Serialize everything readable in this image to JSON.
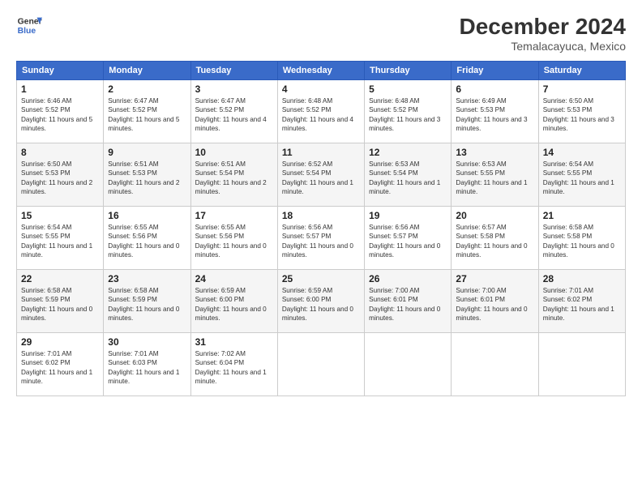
{
  "logo": {
    "line1": "General",
    "line2": "Blue"
  },
  "title": "December 2024",
  "subtitle": "Temalacayuca, Mexico",
  "weekdays": [
    "Sunday",
    "Monday",
    "Tuesday",
    "Wednesday",
    "Thursday",
    "Friday",
    "Saturday"
  ],
  "weeks": [
    [
      {
        "day": "1",
        "info": "Sunrise: 6:46 AM\nSunset: 5:52 PM\nDaylight: 11 hours and 5 minutes."
      },
      {
        "day": "2",
        "info": "Sunrise: 6:47 AM\nSunset: 5:52 PM\nDaylight: 11 hours and 5 minutes."
      },
      {
        "day": "3",
        "info": "Sunrise: 6:47 AM\nSunset: 5:52 PM\nDaylight: 11 hours and 4 minutes."
      },
      {
        "day": "4",
        "info": "Sunrise: 6:48 AM\nSunset: 5:52 PM\nDaylight: 11 hours and 4 minutes."
      },
      {
        "day": "5",
        "info": "Sunrise: 6:48 AM\nSunset: 5:52 PM\nDaylight: 11 hours and 3 minutes."
      },
      {
        "day": "6",
        "info": "Sunrise: 6:49 AM\nSunset: 5:53 PM\nDaylight: 11 hours and 3 minutes."
      },
      {
        "day": "7",
        "info": "Sunrise: 6:50 AM\nSunset: 5:53 PM\nDaylight: 11 hours and 3 minutes."
      }
    ],
    [
      {
        "day": "8",
        "info": "Sunrise: 6:50 AM\nSunset: 5:53 PM\nDaylight: 11 hours and 2 minutes."
      },
      {
        "day": "9",
        "info": "Sunrise: 6:51 AM\nSunset: 5:53 PM\nDaylight: 11 hours and 2 minutes."
      },
      {
        "day": "10",
        "info": "Sunrise: 6:51 AM\nSunset: 5:54 PM\nDaylight: 11 hours and 2 minutes."
      },
      {
        "day": "11",
        "info": "Sunrise: 6:52 AM\nSunset: 5:54 PM\nDaylight: 11 hours and 1 minute."
      },
      {
        "day": "12",
        "info": "Sunrise: 6:53 AM\nSunset: 5:54 PM\nDaylight: 11 hours and 1 minute."
      },
      {
        "day": "13",
        "info": "Sunrise: 6:53 AM\nSunset: 5:55 PM\nDaylight: 11 hours and 1 minute."
      },
      {
        "day": "14",
        "info": "Sunrise: 6:54 AM\nSunset: 5:55 PM\nDaylight: 11 hours and 1 minute."
      }
    ],
    [
      {
        "day": "15",
        "info": "Sunrise: 6:54 AM\nSunset: 5:55 PM\nDaylight: 11 hours and 1 minute."
      },
      {
        "day": "16",
        "info": "Sunrise: 6:55 AM\nSunset: 5:56 PM\nDaylight: 11 hours and 0 minutes."
      },
      {
        "day": "17",
        "info": "Sunrise: 6:55 AM\nSunset: 5:56 PM\nDaylight: 11 hours and 0 minutes."
      },
      {
        "day": "18",
        "info": "Sunrise: 6:56 AM\nSunset: 5:57 PM\nDaylight: 11 hours and 0 minutes."
      },
      {
        "day": "19",
        "info": "Sunrise: 6:56 AM\nSunset: 5:57 PM\nDaylight: 11 hours and 0 minutes."
      },
      {
        "day": "20",
        "info": "Sunrise: 6:57 AM\nSunset: 5:58 PM\nDaylight: 11 hours and 0 minutes."
      },
      {
        "day": "21",
        "info": "Sunrise: 6:58 AM\nSunset: 5:58 PM\nDaylight: 11 hours and 0 minutes."
      }
    ],
    [
      {
        "day": "22",
        "info": "Sunrise: 6:58 AM\nSunset: 5:59 PM\nDaylight: 11 hours and 0 minutes."
      },
      {
        "day": "23",
        "info": "Sunrise: 6:58 AM\nSunset: 5:59 PM\nDaylight: 11 hours and 0 minutes."
      },
      {
        "day": "24",
        "info": "Sunrise: 6:59 AM\nSunset: 6:00 PM\nDaylight: 11 hours and 0 minutes."
      },
      {
        "day": "25",
        "info": "Sunrise: 6:59 AM\nSunset: 6:00 PM\nDaylight: 11 hours and 0 minutes."
      },
      {
        "day": "26",
        "info": "Sunrise: 7:00 AM\nSunset: 6:01 PM\nDaylight: 11 hours and 0 minutes."
      },
      {
        "day": "27",
        "info": "Sunrise: 7:00 AM\nSunset: 6:01 PM\nDaylight: 11 hours and 0 minutes."
      },
      {
        "day": "28",
        "info": "Sunrise: 7:01 AM\nSunset: 6:02 PM\nDaylight: 11 hours and 1 minute."
      }
    ],
    [
      {
        "day": "29",
        "info": "Sunrise: 7:01 AM\nSunset: 6:02 PM\nDaylight: 11 hours and 1 minute."
      },
      {
        "day": "30",
        "info": "Sunrise: 7:01 AM\nSunset: 6:03 PM\nDaylight: 11 hours and 1 minute."
      },
      {
        "day": "31",
        "info": "Sunrise: 7:02 AM\nSunset: 6:04 PM\nDaylight: 11 hours and 1 minute."
      },
      null,
      null,
      null,
      null
    ]
  ]
}
